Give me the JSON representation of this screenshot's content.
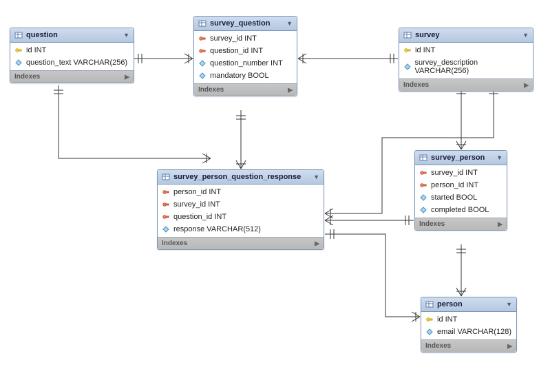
{
  "entities": {
    "question": {
      "title": "question",
      "indexes_label": "Indexes",
      "columns": [
        {
          "name": "id INT",
          "icon": "pk"
        },
        {
          "name": "question_text VARCHAR(256)",
          "icon": "attr"
        }
      ]
    },
    "survey_question": {
      "title": "survey_question",
      "indexes_label": "Indexes",
      "columns": [
        {
          "name": "survey_id INT",
          "icon": "fk"
        },
        {
          "name": "question_id INT",
          "icon": "fk"
        },
        {
          "name": "question_number INT",
          "icon": "attr"
        },
        {
          "name": "mandatory BOOL",
          "icon": "attr"
        }
      ]
    },
    "survey": {
      "title": "survey",
      "indexes_label": "Indexes",
      "columns": [
        {
          "name": "id INT",
          "icon": "pk"
        },
        {
          "name": "survey_description VARCHAR(256)",
          "icon": "attr"
        }
      ]
    },
    "survey_person": {
      "title": "survey_person",
      "indexes_label": "Indexes",
      "columns": [
        {
          "name": "survey_id INT",
          "icon": "fk"
        },
        {
          "name": "person_id INT",
          "icon": "fk"
        },
        {
          "name": "started BOOL",
          "icon": "attr"
        },
        {
          "name": "completed BOOL",
          "icon": "attr"
        }
      ]
    },
    "survey_person_question_response": {
      "title": "survey_person_question_response",
      "indexes_label": "Indexes",
      "columns": [
        {
          "name": "person_id INT",
          "icon": "fk"
        },
        {
          "name": "survey_id INT",
          "icon": "fk"
        },
        {
          "name": "question_id INT",
          "icon": "fk"
        },
        {
          "name": "response VARCHAR(512)",
          "icon": "attr"
        }
      ]
    },
    "person": {
      "title": "person",
      "indexes_label": "Indexes",
      "columns": [
        {
          "name": "id INT",
          "icon": "pk"
        },
        {
          "name": "email VARCHAR(128)",
          "icon": "attr"
        }
      ]
    }
  },
  "icons": {
    "pk": "key",
    "fk": "red-key",
    "attr": "diamond"
  },
  "relationships": [
    {
      "from": "question",
      "to": "survey_question"
    },
    {
      "from": "survey",
      "to": "survey_question"
    },
    {
      "from": "question",
      "to": "survey_person_question_response"
    },
    {
      "from": "survey",
      "to": "survey_person"
    },
    {
      "from": "survey_person",
      "to": "survey_person_question_response"
    },
    {
      "from": "survey_person",
      "to": "person"
    },
    {
      "from": "survey_question",
      "to": "survey_person_question_response"
    }
  ]
}
